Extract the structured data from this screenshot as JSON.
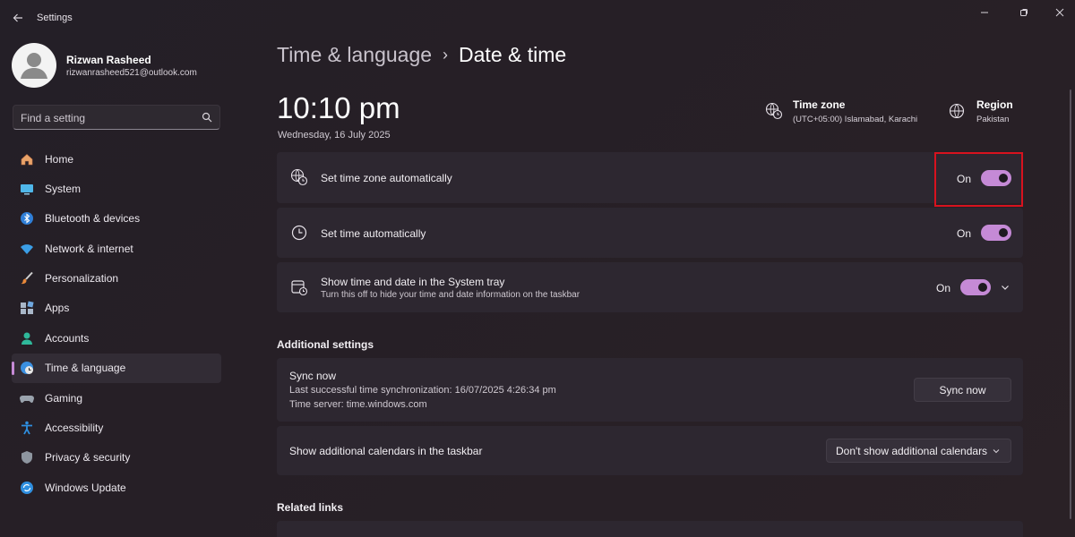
{
  "app": {
    "title": "Settings"
  },
  "profile": {
    "name": "Rizwan Rasheed",
    "email": "rizwanrasheed521@outlook.com"
  },
  "search": {
    "placeholder": "Find a setting"
  },
  "nav": {
    "items": [
      {
        "label": "Home",
        "icon": "home-icon"
      },
      {
        "label": "System",
        "icon": "monitor-icon"
      },
      {
        "label": "Bluetooth & devices",
        "icon": "bluetooth-icon"
      },
      {
        "label": "Network & internet",
        "icon": "wifi-icon"
      },
      {
        "label": "Personalization",
        "icon": "brush-icon"
      },
      {
        "label": "Apps",
        "icon": "apps-icon"
      },
      {
        "label": "Accounts",
        "icon": "person-icon"
      },
      {
        "label": "Time & language",
        "icon": "globe-clock-icon",
        "selected": true
      },
      {
        "label": "Gaming",
        "icon": "gamepad-icon"
      },
      {
        "label": "Accessibility",
        "icon": "accessibility-icon"
      },
      {
        "label": "Privacy & security",
        "icon": "shield-icon"
      },
      {
        "label": "Windows Update",
        "icon": "update-icon"
      }
    ]
  },
  "breadcrumb": {
    "parent": "Time & language",
    "separator": "›",
    "current": "Date & time"
  },
  "clock": {
    "time": "10:10 pm",
    "date": "Wednesday, 16 July 2025"
  },
  "timezone": {
    "title": "Time zone",
    "value": "(UTC+05:00) Islamabad, Karachi"
  },
  "region": {
    "title": "Region",
    "value": "Pakistan"
  },
  "settings": {
    "auto_timezone": {
      "label": "Set time zone automatically",
      "state": "On"
    },
    "auto_time": {
      "label": "Set time automatically",
      "state": "On"
    },
    "tray": {
      "label": "Show time and date in the System tray",
      "sub": "Turn this off to hide your time and date information on the taskbar",
      "state": "On"
    }
  },
  "additional": {
    "heading": "Additional settings",
    "sync": {
      "title": "Sync now",
      "last": "Last successful time synchronization: 16/07/2025 4:26:34 pm",
      "server": "Time server: time.windows.com",
      "button": "Sync now"
    },
    "calendars": {
      "label": "Show additional calendars in the taskbar",
      "selected": "Don't show additional calendars"
    }
  },
  "related": {
    "heading": "Related links"
  },
  "colors": {
    "accent": "#c58ad6",
    "highlight_box": "#d8121e",
    "background": "#241f27",
    "card": "#2d2730"
  }
}
